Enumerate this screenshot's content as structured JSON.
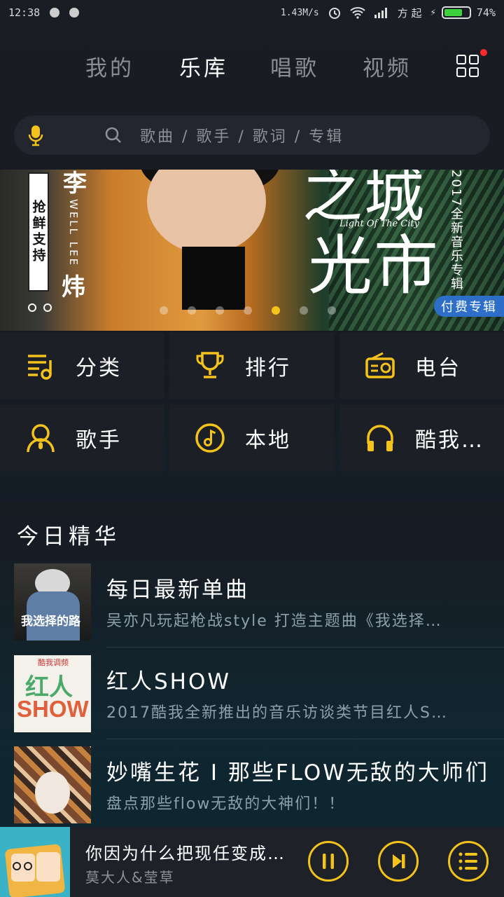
{
  "status_bar": {
    "time": "12:38",
    "speed": "1.43M/s",
    "carrier": "方 起",
    "battery_pct": "74%",
    "battery_level": 0.74
  },
  "nav": {
    "tabs": [
      "我的",
      "乐库",
      "唱歌",
      "视频"
    ],
    "active_tab": "乐库"
  },
  "search": {
    "placeholder": "歌曲 / 歌手 / 歌词 / 专辑"
  },
  "banner": {
    "badge": "抢鲜支持",
    "artist_cn_top": "李",
    "artist_cn_bottom": "炜",
    "artist_en": "WELL LEE",
    "title_cn_top": "之城",
    "title_cn_bottom": "光市",
    "title_en": "Light Of The City",
    "album_vertical": "2017全新音乐专辑",
    "pay_tag": "付费专辑",
    "active_dot": 4,
    "dot_count": 7
  },
  "categories": [
    {
      "label": "分类",
      "icon": "playlist-icon"
    },
    {
      "label": "排行",
      "icon": "trophy-icon"
    },
    {
      "label": "电台",
      "icon": "radio-icon"
    },
    {
      "label": "歌手",
      "icon": "singer-icon"
    },
    {
      "label": "本地",
      "icon": "music-note-icon"
    },
    {
      "label": "酷我…",
      "icon": "headphones-icon"
    }
  ],
  "section": {
    "title": "今日精华",
    "items": [
      {
        "title": "每日最新单曲",
        "subtitle": "吴亦凡玩起枪战style 打造主题曲《我选择…"
      },
      {
        "title": "红人SHOW",
        "subtitle": "2017酷我全新推出的音乐访谈类节目红人S…"
      },
      {
        "title": "妙嘴生花 I 那些FLOW无敌的大师们",
        "subtitle": "盘点那些flow无敌的大神们！！"
      }
    ],
    "thumb1_text": "我选择的路",
    "thumb2_text_top": "红人",
    "thumb2_text_bottom": "SHOW",
    "thumb2_tag": "酷我调频"
  },
  "player": {
    "title": "你因为什么把现任变成…",
    "artist": "莫大人&莹草"
  },
  "colors": {
    "accent": "#f3c21b",
    "background": "#171a21",
    "tile": "#1c1f26",
    "pay_tag": "#2d6ec9"
  }
}
